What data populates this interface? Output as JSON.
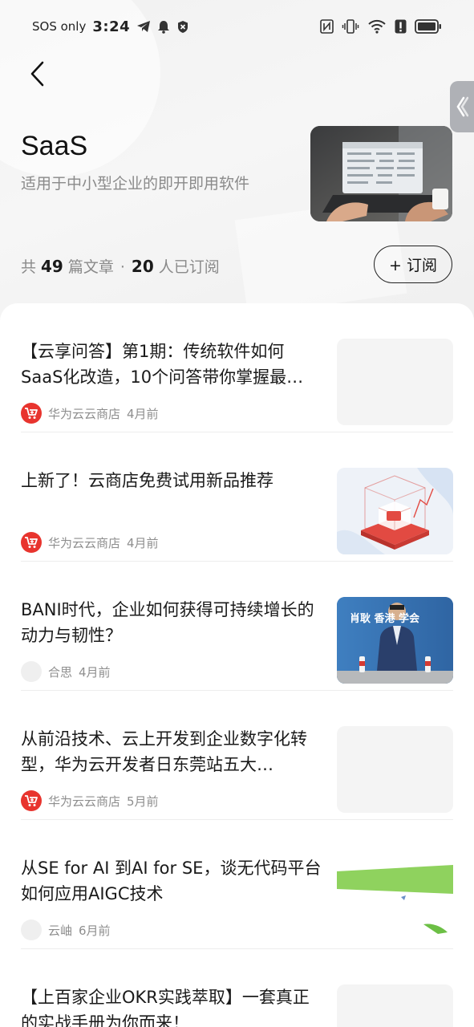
{
  "status_bar": {
    "carrier": "SOS only",
    "time": "3:24",
    "battery_level": 0.85
  },
  "header": {
    "title": "SaaS",
    "subtitle": "适用于中小型企业的即开即用软件",
    "stats_prefix": "共",
    "article_count": "49",
    "articles_label": "篇文章",
    "separator": "·",
    "subscriber_count": "20",
    "subscribers_label": "人已订阅",
    "subscribe_label": "+ 订阅"
  },
  "articles": [
    {
      "title": "【云享问答】第1期：传统软件如何SaaS化改造，10个问答带你掌握最…",
      "source": "华为云云商店",
      "time": "4月前",
      "source_icon": "cart-logo-icon",
      "thumb": "empty"
    },
    {
      "title": "上新了！云商店免费试用新品推荐",
      "source": "华为云云商店",
      "time": "4月前",
      "source_icon": "cart-logo-icon",
      "thumb": "cube-graphic"
    },
    {
      "title": "BANI时代，企业如何获得可持续增长的动力与韧性？",
      "source": "合思",
      "time": "4月前",
      "source_icon": "blank-avatar-icon",
      "thumb": "speaker-photo",
      "thumb_text": "肖耿 香港 学会"
    },
    {
      "title": " 从前沿技术、云上开发到企业数字化转型，华为云开发者日东莞站五大…",
      "source": "华为云云商店",
      "time": "5月前",
      "source_icon": "cart-logo-icon",
      "thumb": "empty"
    },
    {
      "title": "从SE for AI 到AI for SE，谈无代码平台如何应用AIGC技术",
      "source": "云岫",
      "time": "6月前",
      "source_icon": "blank-avatar-icon",
      "thumb": "green-graphic"
    },
    {
      "title": "【上百家企业OKR实践萃取】一套真正的实战手册为你而来！",
      "source": "",
      "time": "",
      "source_icon": "",
      "thumb": "empty"
    }
  ]
}
